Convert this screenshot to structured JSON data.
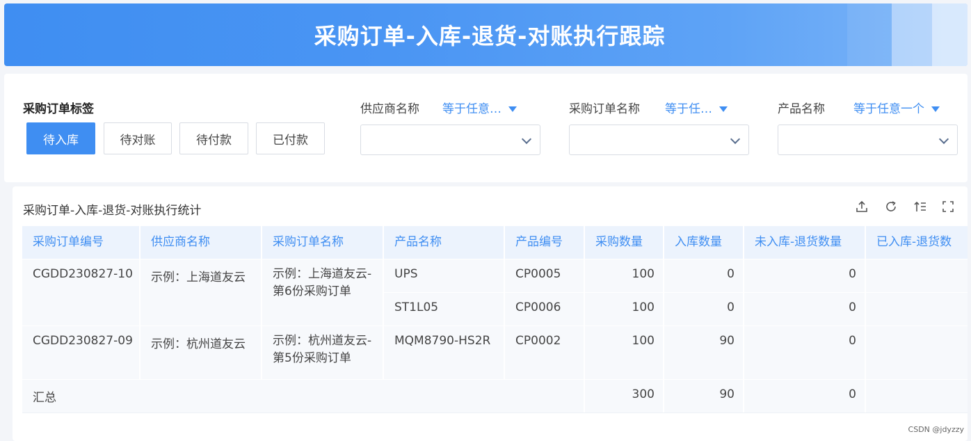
{
  "banner": {
    "title": "采购订单-入库-退货-对账执行跟踪"
  },
  "filters": {
    "tag_title": "采购订单标签",
    "tags": [
      "待入库",
      "待对账",
      "待付款",
      "已付款"
    ],
    "supplier": {
      "label": "供应商名称",
      "operator": "等于任意…"
    },
    "order": {
      "label": "采购订单名称",
      "operator": "等于任…"
    },
    "product": {
      "label": "产品名称",
      "operator": "等于任意一个"
    }
  },
  "table": {
    "title": "采购订单-入库-退货-对账执行统计",
    "toolbar_icons": [
      "export-icon",
      "refresh-icon",
      "sort-icon",
      "fullscreen-icon"
    ],
    "columns": [
      "采购订单编号",
      "供应商名称",
      "采购订单名称",
      "产品名称",
      "产品编号",
      "采购数量",
      "入库数量",
      "未入库-退货数量",
      "已入库-退货数"
    ],
    "rows": [
      {
        "order_no": "CGDD230827-10",
        "supplier": "示例：上海道友云",
        "order_name": "示例：上海道友云-第6份采购订单",
        "items": [
          {
            "product": "UPS",
            "code": "CP0005",
            "qty": "100",
            "in": "0",
            "not_in_return": "0"
          },
          {
            "product": "ST1L05",
            "code": "CP0006",
            "qty": "100",
            "in": "0",
            "not_in_return": "0"
          }
        ]
      },
      {
        "order_no": "CGDD230827-09",
        "supplier": "示例：杭州道友云",
        "order_name": "示例：杭州道友云-第5份采购订单",
        "items": [
          {
            "product": "MQM8790-HS2R",
            "code": "CP0002",
            "qty": "100",
            "in": "90",
            "not_in_return": "0"
          }
        ]
      }
    ],
    "summary": {
      "label": "汇总",
      "qty": "300",
      "in": "90",
      "not_in_return": "0"
    }
  },
  "watermark": "CSDN @jdyzzy"
}
